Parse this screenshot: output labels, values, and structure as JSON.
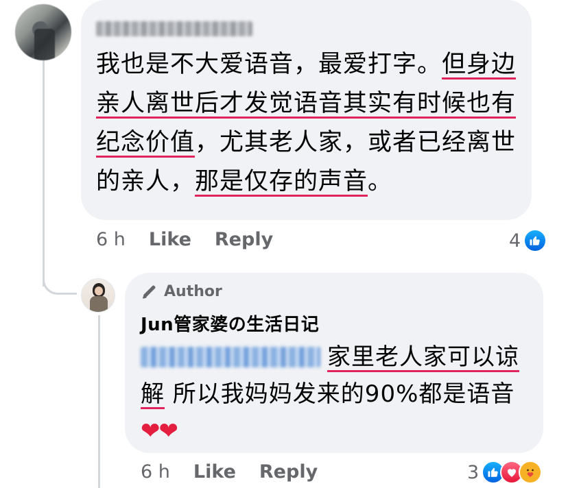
{
  "comment1": {
    "author_name_blurred": "",
    "text_parts": [
      {
        "text": "我也是不大爱语音，最爱打字。",
        "underline": false
      },
      {
        "text": "但身边亲人离世后才发觉语音其实有时候也有纪念价值",
        "underline": true
      },
      {
        "text": "，尤其老人家，或者已经离世的亲人，",
        "underline": false
      },
      {
        "text": "那是仅存的声音",
        "underline": true
      },
      {
        "text": "。",
        "underline": false
      }
    ],
    "time": "6 h",
    "like_label": "Like",
    "reply_label": "Reply",
    "reaction_count": "4",
    "reaction_icons": [
      "like-icon"
    ]
  },
  "reply1": {
    "badge_label": "Author",
    "author_name": "Jun管家婆の生活日记",
    "mention_blurred": "",
    "text_parts": [
      {
        "text": "家里老人家可以谅解",
        "underline": true
      },
      {
        "text": " 所以我妈妈发来的90%都是语音 ",
        "underline": false
      }
    ],
    "emoji": "❤❤",
    "time": "6 h",
    "like_label": "Like",
    "reply_label": "Reply",
    "reaction_count": "3",
    "reaction_icons": [
      "like-icon",
      "love-icon",
      "care-icon"
    ]
  },
  "colors": {
    "bubble_bg": "#f0f2f5",
    "meta_text": "#65676b",
    "underline": "#e0245e",
    "mention_blue": "#216fdb",
    "like_blue": "#1877f2",
    "love_red": "#e41e3f"
  }
}
